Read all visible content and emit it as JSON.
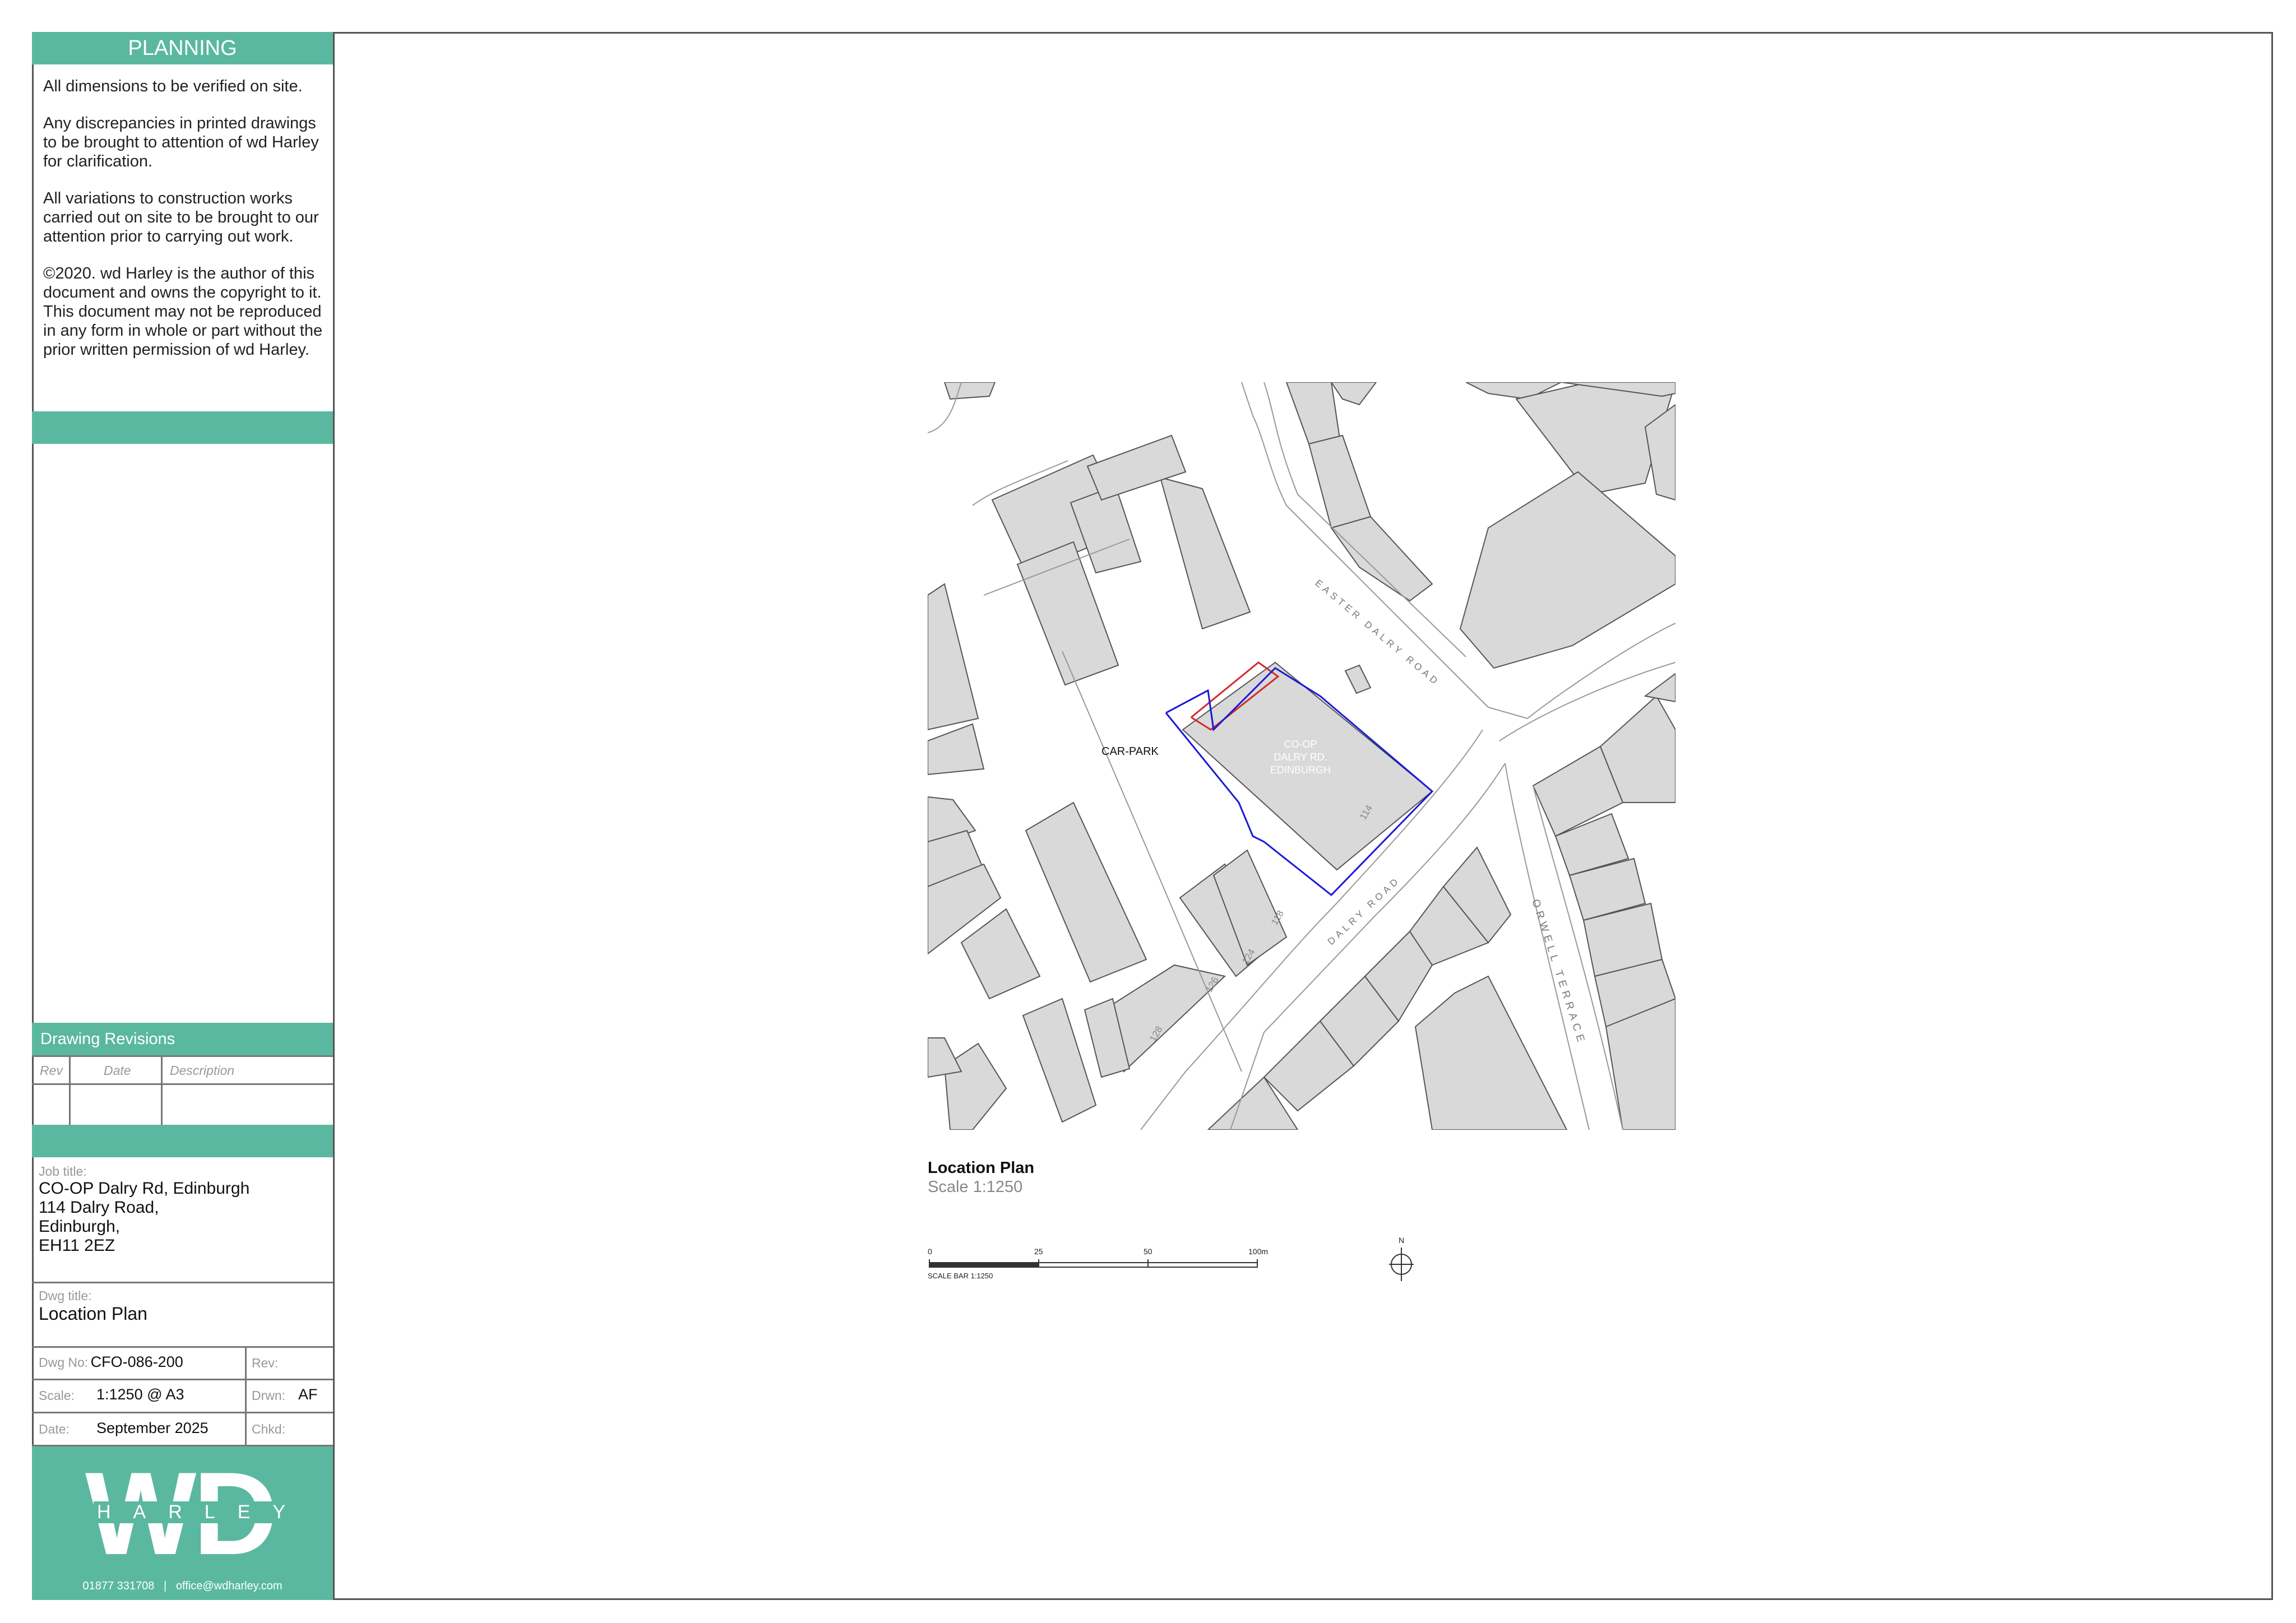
{
  "sidebar": {
    "planning_title": "PLANNING",
    "notes": [
      "All dimensions to be verified on site.",
      "Any discrepancies in printed drawings to be brought to attention of wd Harley for clarification.",
      "All variations to construction works carried out on site to be brought to our attention prior to carrying out work.",
      "©2020. wd Harley is the author of this document and owns the copyright to it. This document may not be reproduced in any form in whole or part without the prior written permission of wd Harley."
    ],
    "revisions": {
      "title": "Drawing Revisions",
      "headers": [
        "Rev",
        "Date",
        "Description"
      ]
    },
    "job": {
      "label": "Job title:",
      "lines": [
        "CO-OP Dalry Rd, Edinburgh",
        "114 Dalry Road,",
        "Edinburgh,",
        "EH11 2EZ"
      ]
    },
    "dwg_title": {
      "label": "Dwg title:",
      "value": "Location Plan"
    },
    "dwg_no": {
      "label": "Dwg No:",
      "value": "CFO-086-200"
    },
    "rev": {
      "label": "Rev:",
      "value": ""
    },
    "scale": {
      "label": "Scale:",
      "value": "1:1250 @ A3"
    },
    "drawn": {
      "label": "Drwn:",
      "value": "AF"
    },
    "date": {
      "label": "Date:",
      "value": "September 2025"
    },
    "checked": {
      "label": "Chkd:",
      "value": ""
    },
    "logo": {
      "letters": "WD",
      "word": "HARLEY",
      "contact": "01877 331708   |   office@wdharley.com"
    }
  },
  "map": {
    "labels": {
      "car_park": "CAR-PARK",
      "site_name": [
        "CO-OP",
        "DALRY RD.",
        "EDINBURGH"
      ],
      "easter_dalry_road": "EASTER DALRY ROAD",
      "dalry_road": "DALRY ROAD",
      "orwell_terrace": "ORWELL TERRACE",
      "numbers": [
        "114",
        "118",
        "124",
        "126",
        "128"
      ]
    },
    "colors": {
      "site_boundary": "#d62828",
      "ownership_boundary": "#1a1ad6",
      "building_fill": "#d9d9d9"
    }
  },
  "caption": {
    "title": "Location Plan",
    "scale": "Scale 1:1250"
  },
  "scale_bar": {
    "ticks": [
      "0",
      "25",
      "50",
      "100m"
    ],
    "label": "SCALE BAR 1:1250",
    "north": "N"
  },
  "colors": {
    "accent": "#5bb8a0",
    "frame": "#555555"
  }
}
